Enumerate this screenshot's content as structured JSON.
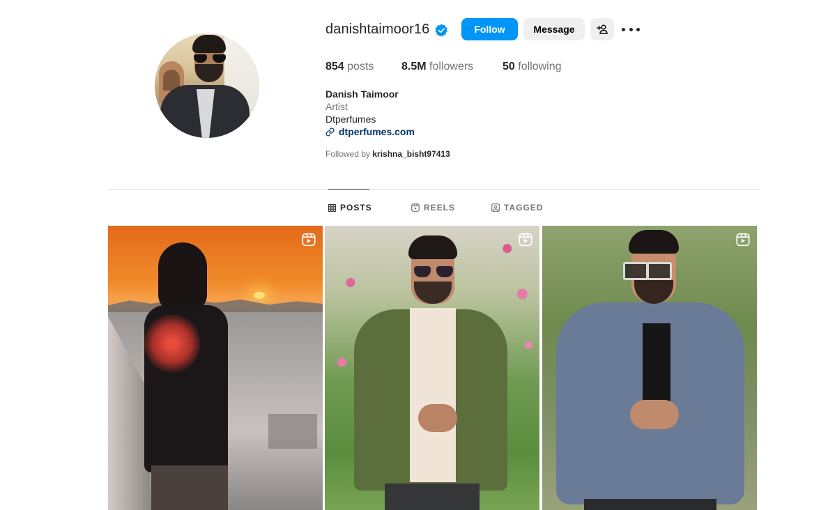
{
  "profile": {
    "username": "danishtaimoor16",
    "verified": true,
    "full_name": "Danish Taimoor",
    "category": "Artist",
    "bio": "Dtperfumes",
    "link": "dtperfumes.com",
    "followed_by_label": "Followed by",
    "followed_by_user": "krishna_bisht97413"
  },
  "actions": {
    "follow_label": "Follow",
    "message_label": "Message",
    "suggest_icon": "add-user-icon",
    "more_icon": "more-options-icon"
  },
  "stats": {
    "posts_count": "854",
    "posts_label": "posts",
    "followers_count": "8.5M",
    "followers_label": "followers",
    "following_count": "50",
    "following_label": "following"
  },
  "tabs": [
    {
      "label": "POSTS",
      "icon": "grid-icon",
      "active": true
    },
    {
      "label": "REELS",
      "icon": "reels-icon",
      "active": false
    },
    {
      "label": "TAGGED",
      "icon": "tagged-icon",
      "active": false
    }
  ],
  "posts": [
    {
      "type": "reel",
      "icon": "reel-badge-icon"
    },
    {
      "type": "reel",
      "icon": "reel-badge-icon"
    },
    {
      "type": "reel",
      "icon": "reel-badge-icon"
    }
  ],
  "colors": {
    "accent": "#0095f6",
    "link": "#00376b",
    "muted": "#737373",
    "text": "#262626",
    "button_secondary": "#efefef",
    "divider": "#dbdbdb"
  }
}
